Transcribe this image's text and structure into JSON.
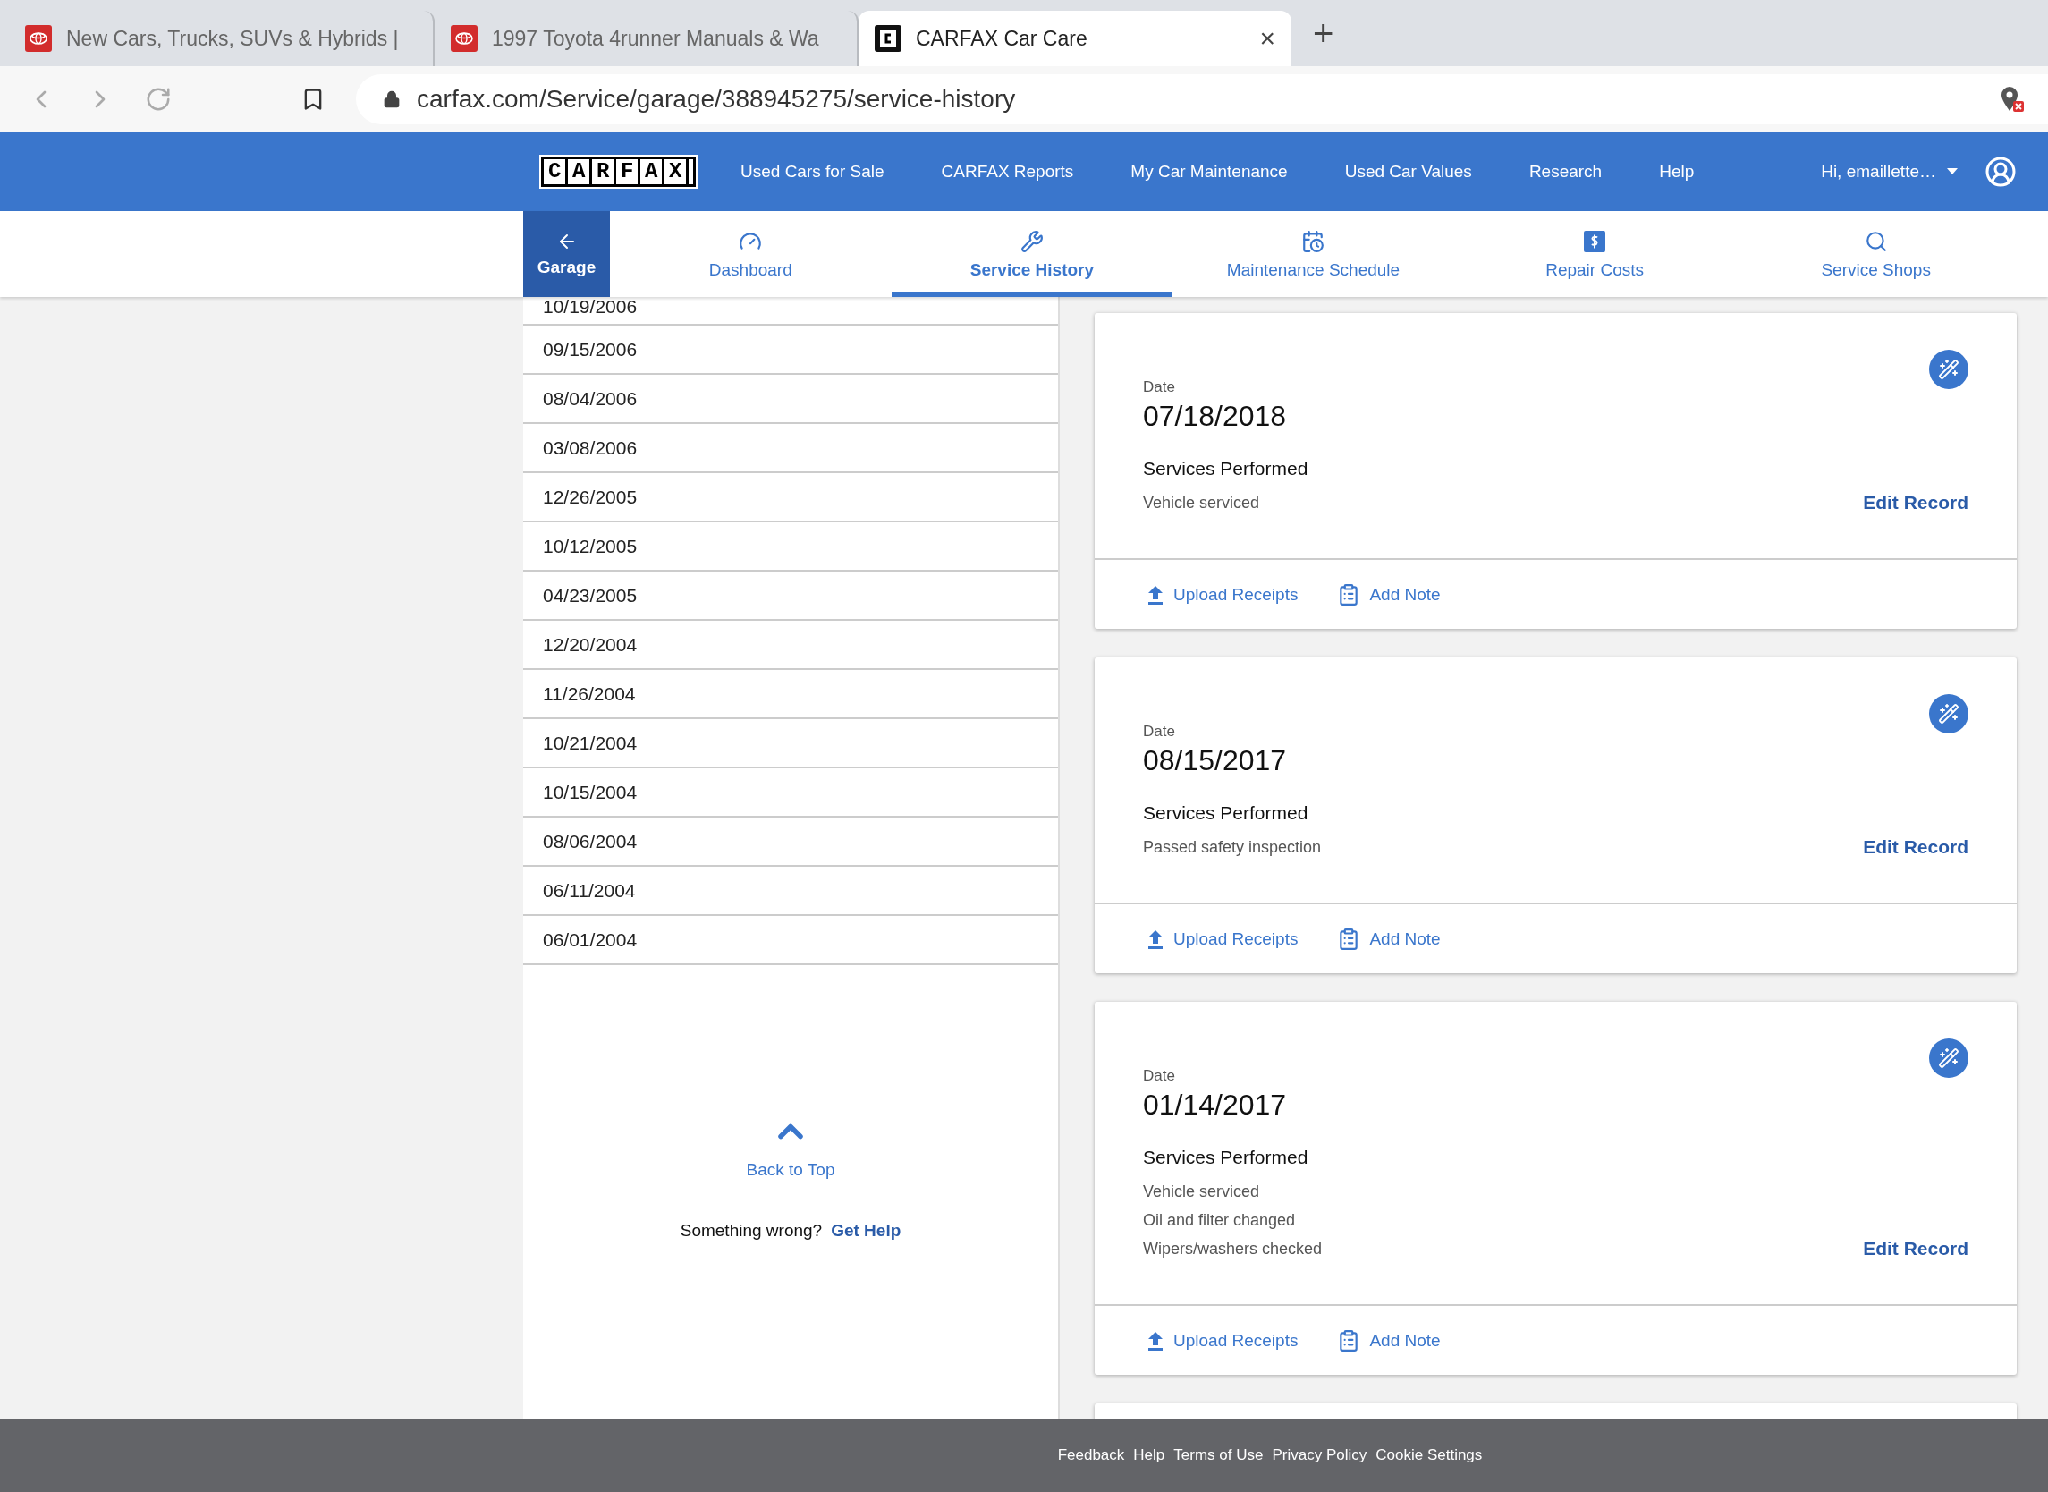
{
  "browser": {
    "tabs": [
      {
        "title": "New Cars, Trucks, SUVs & Hybrids |",
        "selected": false
      },
      {
        "title": "1997 Toyota 4runner Manuals & Wa",
        "selected": false
      },
      {
        "title": "CARFAX Car Care",
        "selected": true
      }
    ],
    "new_tab": "+",
    "close": "×",
    "url": "carfax.com/Service/garage/388945275/service-history"
  },
  "nav": {
    "logo": "CARFAX",
    "links": [
      "Used Cars for Sale",
      "CARFAX Reports",
      "My Car Maintenance",
      "Used Car Values",
      "Research",
      "Help"
    ],
    "user": "Hi, emaillette…"
  },
  "subnav": {
    "back": "Garage",
    "tabs": [
      {
        "label": "Dashboard",
        "selected": false
      },
      {
        "label": "Service History",
        "selected": true
      },
      {
        "label": "Maintenance Schedule",
        "selected": false
      },
      {
        "label": "Repair Costs",
        "selected": false
      },
      {
        "label": "Service Shops",
        "selected": false
      }
    ]
  },
  "history_dates": [
    "10/19/2006",
    "09/15/2006",
    "08/04/2006",
    "03/08/2006",
    "12/26/2005",
    "10/12/2005",
    "04/23/2005",
    "12/20/2004",
    "11/26/2004",
    "10/21/2004",
    "10/15/2004",
    "08/06/2004",
    "06/11/2004",
    "06/01/2004"
  ],
  "back_to_top": "Back to Top",
  "help": {
    "text": "Something wrong?",
    "link": "Get Help"
  },
  "records": [
    {
      "date_label": "Date",
      "date": "07/18/2018",
      "services_title": "Services Performed",
      "services": [
        "Vehicle serviced"
      ],
      "edit": "Edit Record",
      "upload": "Upload Receipts",
      "note": "Add Note"
    },
    {
      "date_label": "Date",
      "date": "08/15/2017",
      "services_title": "Services Performed",
      "services": [
        "Passed safety inspection"
      ],
      "edit": "Edit Record",
      "upload": "Upload Receipts",
      "note": "Add Note"
    },
    {
      "date_label": "Date",
      "date": "01/14/2017",
      "services_title": "Services Performed",
      "services": [
        "Vehicle serviced",
        "Oil and filter changed",
        "Wipers/washers checked"
      ],
      "edit": "Edit Record",
      "upload": "Upload Receipts",
      "note": "Add Note"
    }
  ],
  "footer": {
    "links": [
      "Feedback",
      "Help",
      "Terms of Use",
      "Privacy Policy",
      "Cookie Settings"
    ]
  }
}
